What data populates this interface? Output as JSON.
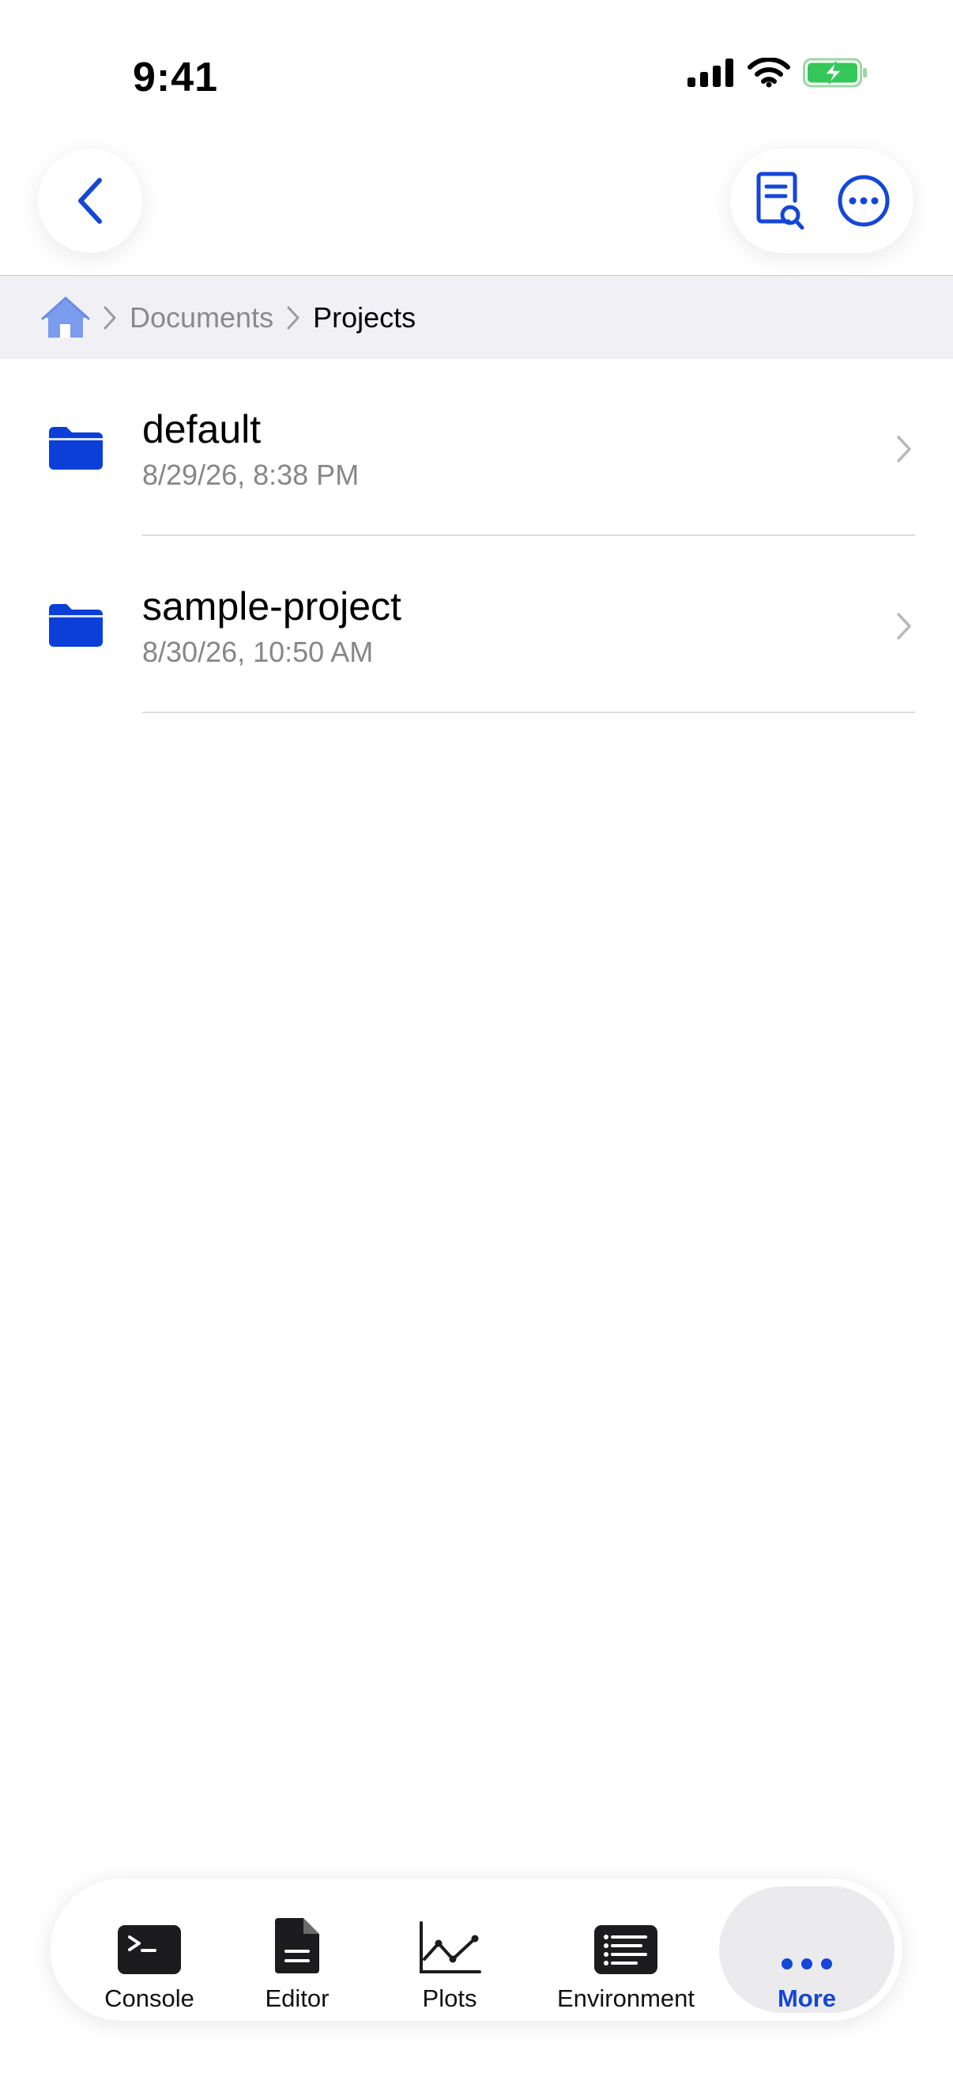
{
  "status_bar": {
    "time": "9:41"
  },
  "breadcrumb": {
    "items": [
      "Documents",
      "Projects"
    ]
  },
  "files": [
    {
      "name": "default",
      "date": "8/29/26, 8:38 PM",
      "icon": "folder-icon"
    },
    {
      "name": "sample-project",
      "date": "8/30/26, 10:50 AM",
      "icon": "folder-icon"
    }
  ],
  "tabs": [
    {
      "label": "Console",
      "icon": "terminal-icon"
    },
    {
      "label": "Editor",
      "icon": "document-icon"
    },
    {
      "label": "Plots",
      "icon": "line-chart-icon"
    },
    {
      "label": "Environment",
      "icon": "list-icon"
    },
    {
      "label": "More",
      "icon": "ellipsis-icon",
      "active": true
    }
  ],
  "colors": {
    "accent": "#1446d8",
    "folder": "#0b3fd8",
    "battery": "#34c759"
  }
}
